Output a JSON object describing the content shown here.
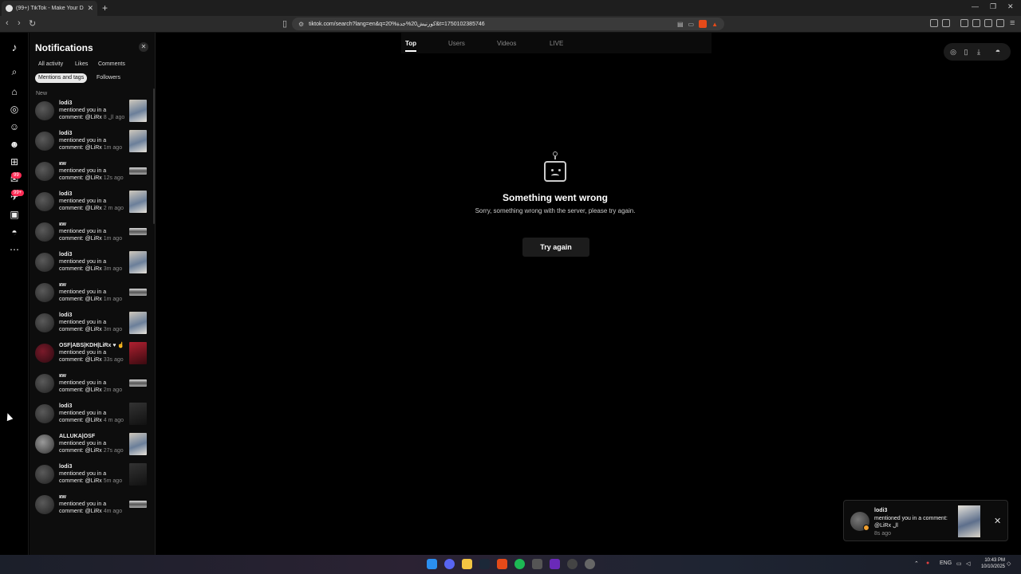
{
  "browser": {
    "tab_title": "(99+) TikTok - Make Your Day",
    "url": "tiktok.com/search?lang=en&q=20%کورنیش20%جدة&t=1750102385746"
  },
  "sidebar": {
    "title": "Notifications",
    "filters": [
      "All activity",
      "Likes",
      "Comments",
      "Mentions and tags",
      "Followers"
    ],
    "active_filter": "Mentions and tags",
    "section_label": "New",
    "badges": [
      "99",
      "99+"
    ]
  },
  "notifications": [
    {
      "name": "lodi3",
      "text": "mentioned you in a comment: @LiRx",
      "time": "8 ال ago",
      "thumb": "photo",
      "avatar": "dark"
    },
    {
      "name": "lodi3",
      "text": "mentioned you in a comment: @LiRx",
      "time": "1m ago",
      "thumb": "photo",
      "avatar": "dark"
    },
    {
      "name": "кw",
      "text": "mentioned you in a comment: @LiRx",
      "time": "12s ago",
      "thumb": "wide",
      "avatar": "dark"
    },
    {
      "name": "lodi3",
      "text": "mentioned you in a comment: @LiRx",
      "time": "2 m ago",
      "thumb": "photo",
      "avatar": "dark"
    },
    {
      "name": "кw",
      "text": "mentioned you in a comment: @LiRx",
      "time": "1m ago",
      "thumb": "wide",
      "avatar": "dark"
    },
    {
      "name": "lodi3",
      "text": "mentioned you in a comment: @LiRx",
      "time": "3m ago",
      "thumb": "photo",
      "avatar": "dark"
    },
    {
      "name": "кw",
      "text": "mentioned you in a comment: @LiRx",
      "time": "1m ago",
      "thumb": "wide",
      "avatar": "dark"
    },
    {
      "name": "lodi3",
      "text": "mentioned you in a comment: @LiRx",
      "time": "3m ago",
      "thumb": "photo",
      "avatar": "dark"
    },
    {
      "name": "OSF|ABS|KDH|LiRx ♥ ☝",
      "text": "mentioned you in a comment: @LiRx",
      "time": "33s ago",
      "thumb": "red",
      "avatar": "red"
    },
    {
      "name": "кw",
      "text": "mentioned you in a comment: @LiRx",
      "time": "2m ago",
      "thumb": "wide",
      "avatar": "dark"
    },
    {
      "name": "lodi3",
      "text": "mentioned you in a comment: @LiRx",
      "time": "4 m ago",
      "thumb": "dark",
      "avatar": "dark"
    },
    {
      "name": "ALLUKA|OSF",
      "text": "mentioned you in a comment: @LiRx",
      "time": "27s ago",
      "thumb": "photo",
      "avatar": "grey"
    },
    {
      "name": "lodi3",
      "text": "mentioned you in a comment: @LiRx",
      "time": "5m ago",
      "thumb": "dark",
      "avatar": "dark"
    },
    {
      "name": "кw",
      "text": "mentioned you in a comment: @LiRx",
      "time": "4m ago",
      "thumb": "wide",
      "avatar": "dark"
    }
  ],
  "search_tabs": [
    "Top",
    "Users",
    "Videos",
    "LIVE"
  ],
  "active_search_tab": "Top",
  "error": {
    "title": "Something went wrong",
    "message": "Sorry, something wrong with the server, please try again.",
    "button": "Try again"
  },
  "toast": {
    "name": "lodi3",
    "text": "mentioned you in a comment: @LiRx ال",
    "time": "8s ago"
  },
  "taskbar": {
    "lang": "ENG",
    "time": "10:43 PM",
    "date": "10/10/2025"
  },
  "colors": {
    "accent": "#fe2c55",
    "background": "#000000",
    "panel": "#0d0d0d"
  }
}
